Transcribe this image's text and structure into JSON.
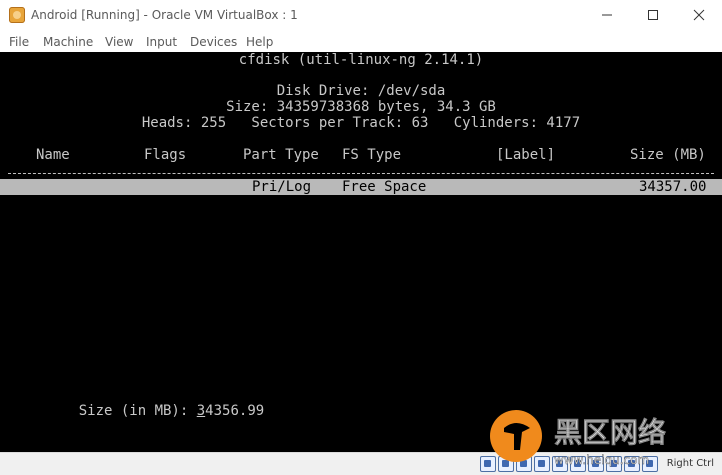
{
  "window": {
    "title": "Android [Running] - Oracle VM VirtualBox : 1",
    "minimize_glyph": "—",
    "maximize_glyph": "☐",
    "close_glyph": "✕"
  },
  "menu": {
    "items": [
      {
        "label": "File"
      },
      {
        "label": "Machine"
      },
      {
        "label": "View"
      },
      {
        "label": "Input"
      },
      {
        "label": "Devices"
      },
      {
        "label": "Help"
      }
    ]
  },
  "cfdisk": {
    "title": "cfdisk (util-linux-ng 2.14.1)",
    "disk_drive": "Disk Drive: /dev/sda",
    "size_line": "Size: 34359738368 bytes, 34.3 GB",
    "geometry": "Heads: 255   Sectors per Track: 63   Cylinders: 4177",
    "columns": {
      "name": "Name",
      "flags": "Flags",
      "part_type": "Part Type",
      "fs_type": "FS Type",
      "label": "[Label]",
      "size": "Size (MB)"
    },
    "row": {
      "part_type": "Pri/Log",
      "fs_type": "Free Space",
      "size": "34357.00"
    },
    "prompt": {
      "label": "Size (in MB): ",
      "value_first": "3",
      "value_rest": "4356.99"
    }
  },
  "status": {
    "host_key": "Right Ctrl"
  },
  "watermark": {
    "text": "黑区网络",
    "url": "www.heiqu.com"
  },
  "colors": {
    "terminal_bg": "#000000",
    "terminal_text": "#c8c8c8",
    "highlight_bg": "#b9b9b9",
    "watermark_orange": "#f08a1c"
  }
}
